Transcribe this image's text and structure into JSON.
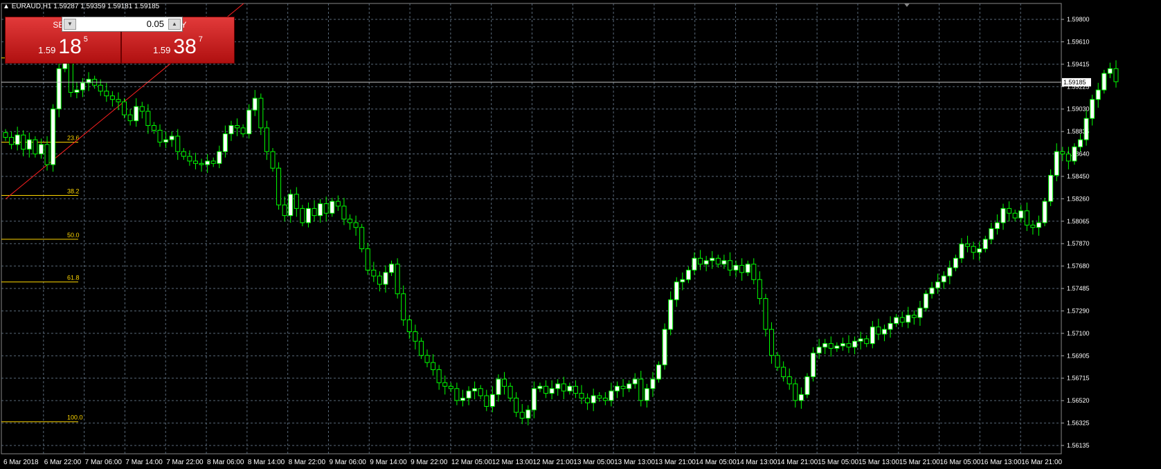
{
  "window": {
    "title_arrow": "▲",
    "symbol": "EURAUD,H1",
    "ohlc": "1.59287 1.59359 1.59181 1.59185"
  },
  "trade_panel": {
    "sell_label": "SELL",
    "buy_label": "BUY",
    "lot_value": "0.05",
    "sell_price": {
      "prefix": "1.59",
      "big": "18",
      "sup": "5"
    },
    "buy_price": {
      "prefix": "1.59",
      "big": "38",
      "sup": "7"
    }
  },
  "price_axis": {
    "labels": [
      "1.59800",
      "1.59610",
      "1.59415",
      "1.59225",
      "1.59030",
      "1.58835",
      "1.58640",
      "1.58450",
      "1.58260",
      "1.58065",
      "1.57870",
      "1.57680",
      "1.57485",
      "1.57290",
      "1.57100",
      "1.56905",
      "1.56715",
      "1.56520",
      "1.56325",
      "1.56135"
    ],
    "current_price": "1.59185"
  },
  "time_axis": {
    "labels": [
      "6 Mar 2018",
      "6 Mar 22:00",
      "7 Mar 06:00",
      "7 Mar 14:00",
      "7 Mar 22:00",
      "8 Mar 06:00",
      "8 Mar 14:00",
      "8 Mar 22:00",
      "9 Mar 06:00",
      "9 Mar 14:00",
      "9 Mar 22:00",
      "12 Mar 05:00",
      "12 Mar 13:00",
      "12 Mar 21:00",
      "13 Mar 05:00",
      "13 Mar 13:00",
      "13 Mar 21:00",
      "14 Mar 05:00",
      "14 Mar 13:00",
      "14 Mar 21:00",
      "15 Mar 05:00",
      "15 Mar 13:00",
      "15 Mar 21:00",
      "16 Mar 05:00",
      "16 Mar 13:00",
      "16 Mar 21:00"
    ]
  },
  "fibonacci": {
    "levels": [
      {
        "label": "0.0",
        "price": 1.5939
      },
      {
        "label": "23.6",
        "price": 1.5868
      },
      {
        "label": "38.2",
        "price": 1.5823
      },
      {
        "label": "50.0",
        "price": 1.5786
      },
      {
        "label": "61.8",
        "price": 1.575
      },
      {
        "label": "100.0",
        "price": 1.5632
      }
    ]
  },
  "colors": {
    "background": "#000000",
    "grid": "#5a6a7a",
    "bull_candle": "#ffffff",
    "bear_candle": "#000000",
    "wick": "#00ff00",
    "fib": "#ffd700",
    "trendline": "#ff2020",
    "axis_text": "#ffffff"
  },
  "chart_data": {
    "type": "candlestick",
    "timeframe": "H1",
    "ylim": [
      1.5605,
      1.5985
    ],
    "closes": [
      1.5872,
      1.5866,
      1.5874,
      1.5862,
      1.587,
      1.5858,
      1.5866,
      1.5849,
      1.5896,
      1.593,
      1.5936,
      1.591,
      1.5912,
      1.5918,
      1.5921,
      1.5916,
      1.5911,
      1.5907,
      1.5904,
      1.5902,
      1.5891,
      1.5886,
      1.5898,
      1.5894,
      1.5882,
      1.5878,
      1.5868,
      1.587,
      1.5873,
      1.586,
      1.5856,
      1.5852,
      1.585,
      1.5849,
      1.5852,
      1.585,
      1.586,
      1.5875,
      1.5882,
      1.588,
      1.5875,
      1.5895,
      1.5905,
      1.588,
      1.586,
      1.5846,
      1.5815,
      1.5806,
      1.5824,
      1.5812,
      1.58,
      1.5812,
      1.5806,
      1.5816,
      1.5808,
      1.5818,
      1.5814,
      1.5803,
      1.58,
      1.5796,
      1.5778,
      1.576,
      1.5755,
      1.5748,
      1.5758,
      1.5765,
      1.574,
      1.5718,
      1.5708,
      1.57,
      1.5688,
      1.5682,
      1.5676,
      1.5665,
      1.5662,
      1.566,
      1.565,
      1.5652,
      1.5658,
      1.566,
      1.5654,
      1.5645,
      1.5655,
      1.5668,
      1.5662,
      1.5652,
      1.564,
      1.5635,
      1.5642,
      1.566,
      1.5662,
      1.5656,
      1.566,
      1.5664,
      1.5658,
      1.5662,
      1.5656,
      1.5652,
      1.5648,
      1.5654,
      1.5652,
      1.565,
      1.5658,
      1.5662,
      1.566,
      1.5664,
      1.5668,
      1.565,
      1.566,
      1.5668,
      1.568,
      1.571,
      1.5735,
      1.575,
      1.5752,
      1.576,
      1.577,
      1.5765,
      1.5768,
      1.577,
      1.5765,
      1.5768,
      1.576,
      1.5764,
      1.5758,
      1.5765,
      1.5752,
      1.5736,
      1.571,
      1.5688,
      1.5678,
      1.567,
      1.5664,
      1.565,
      1.5655,
      1.567,
      1.569,
      1.5695,
      1.5698,
      1.5694,
      1.5696,
      1.5698,
      1.5695,
      1.57,
      1.5702,
      1.5698,
      1.5712,
      1.5706,
      1.571,
      1.5715,
      1.572,
      1.5716,
      1.5722,
      1.572,
      1.5728,
      1.574,
      1.5745,
      1.575,
      1.5755,
      1.5762,
      1.577,
      1.5782,
      1.578,
      1.5775,
      1.5778,
      1.5786,
      1.5795,
      1.58,
      1.5812,
      1.5808,
      1.5804,
      1.581,
      1.5798,
      1.5796,
      1.58,
      1.5818,
      1.584,
      1.586,
      1.5858,
      1.5852,
      1.5864,
      1.587,
      1.5888,
      1.5904,
      1.5912,
      1.5926,
      1.593,
      1.5919
    ]
  }
}
